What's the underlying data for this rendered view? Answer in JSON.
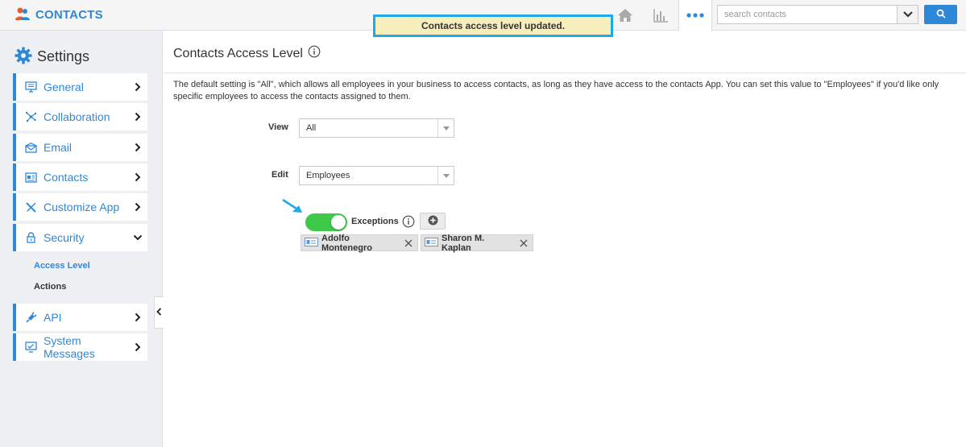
{
  "app": {
    "title": "CONTACTS"
  },
  "toast": {
    "message": "Contacts access level updated."
  },
  "header": {
    "icons": [
      "home-icon",
      "chart-icon",
      "more-icon"
    ],
    "search": {
      "placeholder": "search contacts",
      "value": ""
    }
  },
  "sidebar": {
    "title": "Settings",
    "items": [
      {
        "label": "General",
        "icon": "monitor-icon"
      },
      {
        "label": "Collaboration",
        "icon": "collaboration-icon"
      },
      {
        "label": "Email",
        "icon": "envelope-icon"
      },
      {
        "label": "Contacts",
        "icon": "contact-card-icon"
      },
      {
        "label": "Customize App",
        "icon": "tools-icon"
      },
      {
        "label": "Security",
        "icon": "lock-icon",
        "expanded": true
      },
      {
        "label": "API",
        "icon": "plug-icon"
      },
      {
        "label": "System Messages",
        "icon": "message-icon"
      }
    ],
    "security_sub": [
      {
        "label": "Access Level",
        "active": true
      },
      {
        "label": "Actions",
        "active": false
      }
    ]
  },
  "main": {
    "title": "Contacts Access Level",
    "description": "The default setting is \"All\", which allows all employees in your business to access contacts, as long as they have access to the contacts App. You can set this value to \"Employees\" if you'd like only specific employees to access the contacts assigned to them.",
    "view": {
      "label": "View",
      "value": "All"
    },
    "edit": {
      "label": "Edit",
      "value": "Employees"
    },
    "exceptions": {
      "label": "Exceptions",
      "enabled": true,
      "people": [
        {
          "name": "Adolfo Montenegro"
        },
        {
          "name": "Sharon M. Kaplan"
        }
      ]
    }
  },
  "colors": {
    "accent": "#2f87d8",
    "toggle_on": "#3ec94b",
    "toast_bg": "#f7eebc",
    "toast_border": "#1eaae7"
  }
}
